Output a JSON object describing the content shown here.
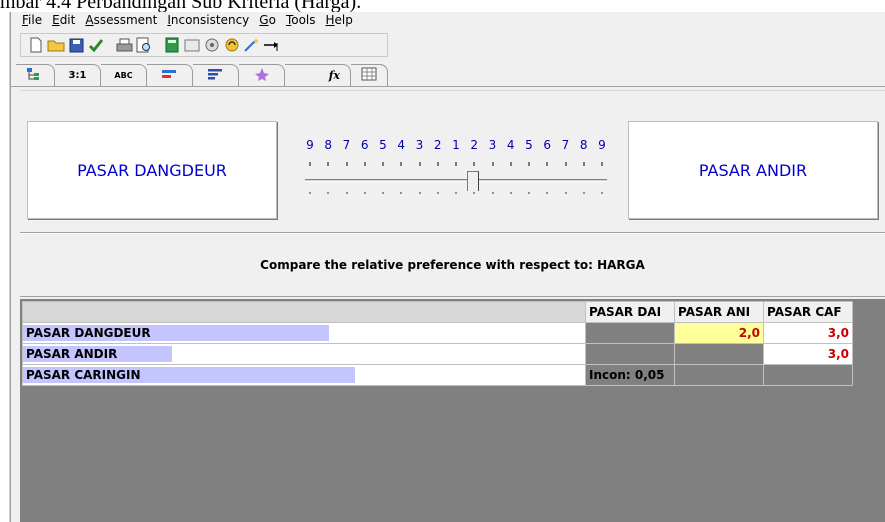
{
  "doc_caption": "mbar 4.4 Perbandingan Sub Kriteria (Harga).",
  "menu": [
    {
      "label": "File",
      "u": "F",
      "rest": "ile"
    },
    {
      "label": "Edit",
      "u": "E",
      "rest": "dit"
    },
    {
      "label": "Assessment",
      "u": "A",
      "rest": "ssessment"
    },
    {
      "label": "Inconsistency",
      "u": "I",
      "rest": "nconsistency"
    },
    {
      "label": "Go",
      "u": "G",
      "rest": "o"
    },
    {
      "label": "Tools",
      "u": "T",
      "rest": "ools"
    },
    {
      "label": "Help",
      "u": "H",
      "rest": "elp"
    }
  ],
  "toolbar_icons": [
    "new-file-icon",
    "open-folder-icon",
    "save-icon",
    "check-icon",
    "print-icon",
    "print-preview-icon",
    "calculator-icon",
    "sheet-icon",
    "network-icon",
    "refresh-icon",
    "wand-icon",
    "arrow-icon"
  ],
  "tabs": [
    {
      "label": "",
      "icon": "tree-icon"
    },
    {
      "label": "3:1",
      "icon": ""
    },
    {
      "label": "ABC",
      "icon": ""
    },
    {
      "label": "",
      "icon": "bar-red-icon"
    },
    {
      "label": "",
      "icon": "bars-icon"
    },
    {
      "label": "",
      "icon": "wand-tab-icon"
    },
    {
      "label": "",
      "icon": "fx-icon"
    },
    {
      "label": "",
      "icon": "grid-icon"
    }
  ],
  "comparison": {
    "left_item": "PASAR DANGDEUR",
    "right_item": "PASAR ANDIR",
    "scale_labels": [
      "9",
      "8",
      "7",
      "6",
      "5",
      "4",
      "3",
      "2",
      "1",
      "2",
      "3",
      "4",
      "5",
      "6",
      "7",
      "8",
      "9"
    ],
    "slider_value": 2,
    "slider_side": "left",
    "prompt": "Compare the relative preference with respect to: HARGA"
  },
  "matrix": {
    "columns": [
      "PASAR DAI",
      "PASAR ANI",
      "PASAR CAF"
    ],
    "rows": [
      {
        "label": "PASAR DANGDEUR",
        "bar_fraction": 0.545,
        "cells": [
          "",
          "2,0",
          "3,0"
        ]
      },
      {
        "label": "PASAR ANDIR",
        "bar_fraction": 0.265,
        "cells": [
          "",
          "",
          "3,0"
        ]
      },
      {
        "label": "PASAR CARINGIN",
        "bar_fraction": 0.59,
        "cells": [
          "Incon: 0,05",
          "",
          ""
        ]
      }
    ]
  },
  "colors": {
    "item_text": "#0000cc",
    "value_text": "#cc0000",
    "highlight": "#ffff99",
    "priority_bar": "#c4c4ff"
  }
}
